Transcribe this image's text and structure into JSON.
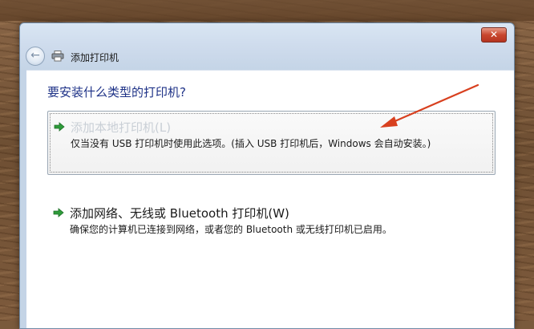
{
  "window": {
    "title": "添加打印机",
    "close_label": "✕"
  },
  "nav": {
    "back_icon": "back-arrow-icon",
    "printer_icon": "printer-icon"
  },
  "main": {
    "question": "要安装什么类型的打印机?",
    "options": [
      {
        "title": "添加本地打印机(L)",
        "description": "仅当没有 USB 打印机时使用此选项。(插入 USB 打印机后，Windows 会自动安装。)",
        "icon": "green-arrow-icon"
      },
      {
        "title": "添加网络、无线或 Bluetooth 打印机(W)",
        "description": "确保您的计算机已连接到网络，或者您的 Bluetooth 或无线打印机已启用。",
        "icon": "green-arrow-icon"
      }
    ]
  },
  "colors": {
    "question_text": "#1e3287",
    "disabled_text": "#c9cfd6",
    "annotation_arrow": "#d8401f",
    "option_arrow": "#2e9b3a"
  }
}
